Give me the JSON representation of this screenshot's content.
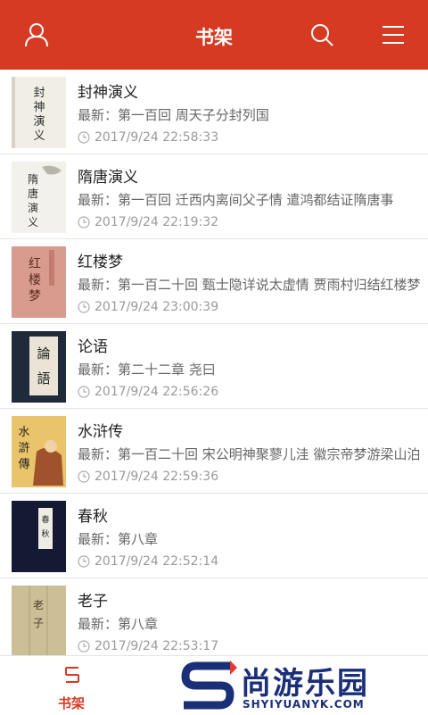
{
  "header": {
    "title": "书架",
    "user_icon": "user-icon",
    "search_icon": "search-icon",
    "menu_icon": "menu-icon",
    "bg": "#d63a23"
  },
  "books": [
    {
      "title": "封神演义",
      "latest": "最新：第一百回 周天子分封列国",
      "time": "2017/9/24 22:58:33",
      "cover_text": "封神演义"
    },
    {
      "title": "隋唐演义",
      "latest": "最新：第一百回 迁西内离间父子情 遣鸿都结证隋唐事",
      "time": "2017/9/24 22:19:32",
      "cover_text": "隋唐演义"
    },
    {
      "title": "红楼梦",
      "latest": "最新：第一百二十回 甄士隐详说太虚情 贾雨村归结红楼梦",
      "time": "2017/9/24 23:00:39",
      "cover_text": "红楼梦"
    },
    {
      "title": "论语",
      "latest": "最新：第二十二章 尧曰",
      "time": "2017/9/24 22:56:26",
      "cover_text": "論語"
    },
    {
      "title": "水浒传",
      "latest": "最新：第一百二十回 宋公明神聚蓼儿洼 徽宗帝梦游梁山泊",
      "time": "2017/9/24 22:59:36",
      "cover_text": "水滸傳"
    },
    {
      "title": "春秋",
      "latest": "最新：第八章",
      "time": "2017/9/24 22:52:14",
      "cover_text": "春秋"
    },
    {
      "title": "老子",
      "latest": "最新：第八章",
      "time": "2017/9/24 22:53:17",
      "cover_text": "老子"
    }
  ],
  "bottom_nav": {
    "active_label": "书架",
    "active_icon": "bookshelf-icon"
  },
  "watermark": {
    "text": "尚游乐园",
    "url": "SHYIYUANYK.COM"
  }
}
